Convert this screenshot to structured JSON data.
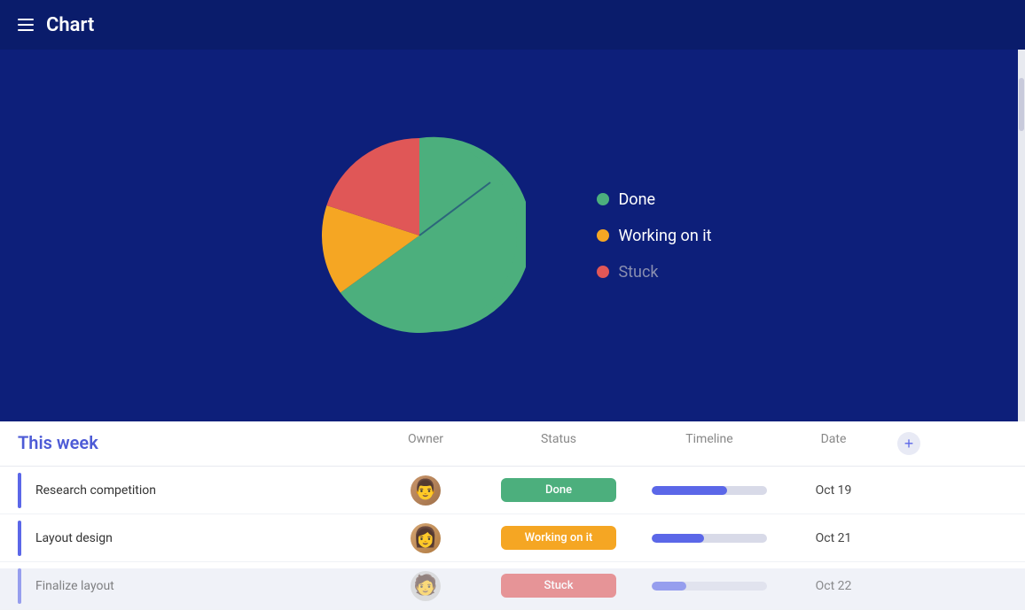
{
  "header": {
    "title": "Chart",
    "menu_icon": "hamburger"
  },
  "chart": {
    "legend": [
      {
        "label": "Done",
        "color": "#4caf7d",
        "id": "done"
      },
      {
        "label": "Working on it",
        "color": "#f5a623",
        "id": "working-on-it"
      },
      {
        "label": "Stuck",
        "color": "#e05757",
        "id": "stuck",
        "muted": true
      }
    ],
    "pie": {
      "done_pct": 65,
      "working_pct": 15,
      "stuck_pct": 20
    }
  },
  "table": {
    "section_title": "This week",
    "columns": {
      "owner": "Owner",
      "status": "Status",
      "timeline": "Timeline",
      "date": "Date"
    },
    "rows": [
      {
        "name": "Research competition",
        "owner": "man",
        "status": "Done",
        "status_type": "done",
        "timeline_pct": 65,
        "date": "Oct 19"
      },
      {
        "name": "Layout design",
        "owner": "woman",
        "status": "Working on it",
        "status_type": "working",
        "timeline_pct": 45,
        "date": "Oct 21"
      },
      {
        "name": "Finalize layout",
        "owner": "person3",
        "status": "Stuck",
        "status_type": "stuck",
        "timeline_pct": 30,
        "date": "Oct 22"
      }
    ]
  }
}
